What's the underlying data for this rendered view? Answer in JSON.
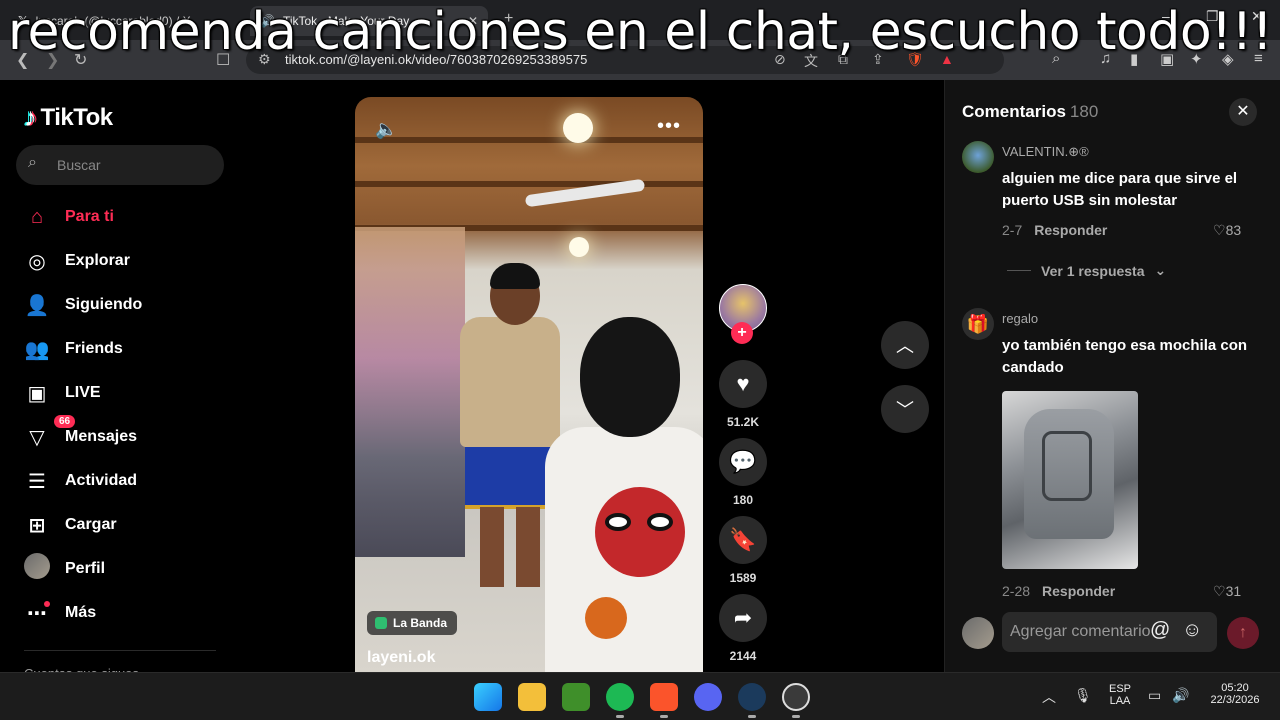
{
  "overlay": {
    "caption": "recomenda canciones en el chat, escucho todo!!!"
  },
  "browser": {
    "tabs": [
      {
        "title": "luccarob (@luccarobled0) / X",
        "active": false
      },
      {
        "title": "TikTok - Make Your Day",
        "active": true
      }
    ],
    "url": "tiktok.com/@layeni.ok/video/7603870269253389575"
  },
  "sidebar": {
    "logo": "TikTok",
    "search_placeholder": "Buscar",
    "items": [
      {
        "label": "Para ti",
        "icon": "home-icon",
        "active": true
      },
      {
        "label": "Explorar",
        "icon": "compass-icon"
      },
      {
        "label": "Siguiendo",
        "icon": "following-icon"
      },
      {
        "label": "Friends",
        "icon": "friends-icon"
      },
      {
        "label": "LIVE",
        "icon": "live-icon"
      },
      {
        "label": "Mensajes",
        "icon": "messages-icon",
        "badge": "66"
      },
      {
        "label": "Actividad",
        "icon": "activity-icon"
      },
      {
        "label": "Cargar",
        "icon": "upload-icon"
      },
      {
        "label": "Perfil",
        "icon": "profile-avatar"
      },
      {
        "label": "Más",
        "icon": "more-icon"
      }
    ],
    "cutoff_text": "Cuentas que sigues"
  },
  "video": {
    "tag": "La Banda",
    "author": "layeni.ok"
  },
  "actions": {
    "likes": "51.2K",
    "comments": "180",
    "saves": "1589",
    "shares": "2144"
  },
  "comments_panel": {
    "title": "Comentarios",
    "count": "180",
    "comments": [
      {
        "user": "VALENTIN.⊕®",
        "text": "alguien me dice para que sirve el puerto USB sin molestar",
        "date": "2-7",
        "reply_label": "Responder",
        "likes": "83",
        "replies_toggle": "Ver 1 respuesta"
      },
      {
        "user": "regalo",
        "text": "yo también tengo esa mochila con candado",
        "date": "2-28",
        "reply_label": "Responder",
        "likes": "31"
      }
    ],
    "input_placeholder": "Agregar comentario..."
  },
  "taskbar": {
    "lang_top": "ESP",
    "lang_bottom": "LAA",
    "time": "05:20",
    "date": "22/3/2026"
  },
  "colors": {
    "accent": "#fe2c55",
    "panel_bg": "#121212",
    "page_bg": "#000000"
  }
}
